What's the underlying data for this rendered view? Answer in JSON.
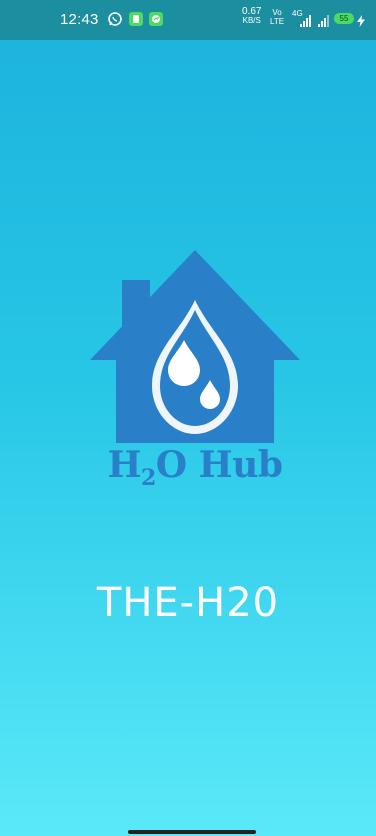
{
  "status_bar": {
    "time": "12:43",
    "net_speed_value": "0.67",
    "net_speed_unit": "KB/S",
    "volte_top": "Vo",
    "volte_bottom": "LTE",
    "signal_label": "4G",
    "battery_level": "55",
    "icons": [
      "whatsapp-icon",
      "notification-icon",
      "messenger-icon",
      "signal-icon",
      "signal-icon",
      "battery-icon",
      "charging-icon"
    ]
  },
  "logo": {
    "text_h": "H",
    "text_sub": "2",
    "text_rest": "O Hub"
  },
  "app": {
    "title": "THE-H20"
  },
  "colors": {
    "status_bar": "#1b8fa0",
    "gradient_top": "#1cb1dc",
    "gradient_bottom": "#5ae9f9",
    "logo_blue": "#2a7fc9",
    "title": "#ffffff"
  }
}
